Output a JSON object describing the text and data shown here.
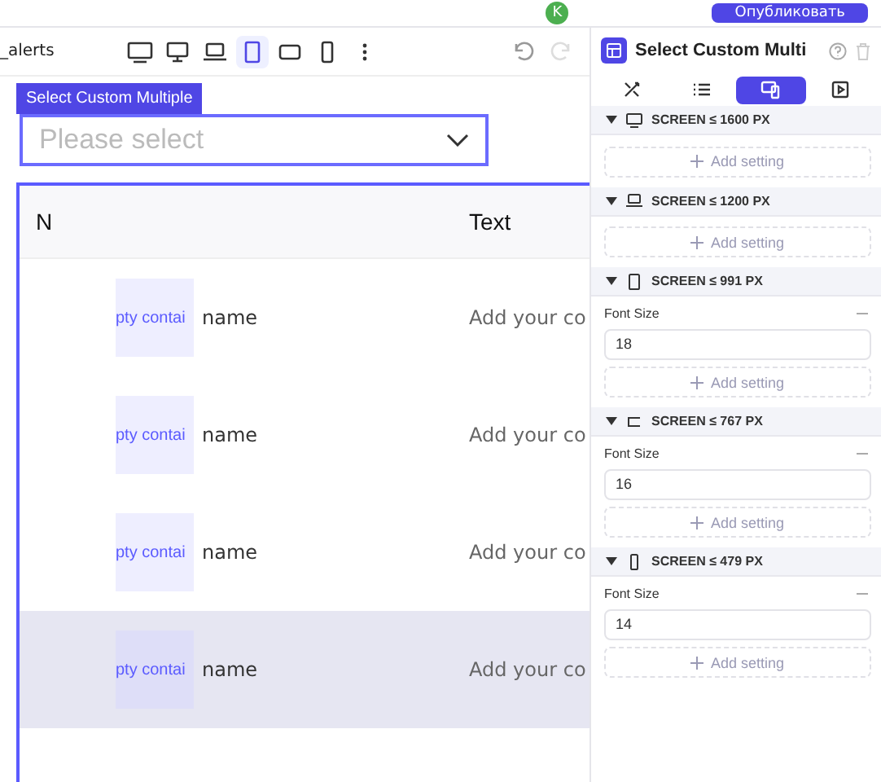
{
  "top_bar": {
    "avatar": "K",
    "publish_button": "Опубликовать"
  },
  "toolbar": {
    "page_name": "_alerts",
    "devices": [
      {
        "kind": "desktop-wide",
        "selected": false
      },
      {
        "kind": "desktop",
        "selected": false
      },
      {
        "kind": "laptop",
        "selected": false
      },
      {
        "kind": "tablet",
        "selected": true
      },
      {
        "kind": "tablet-landscape",
        "selected": false
      },
      {
        "kind": "phone",
        "selected": false
      }
    ]
  },
  "canvas": {
    "select_label": "Select Custom Multiple",
    "select_placeholder": "Please select",
    "table": {
      "columns": [
        "N",
        "Text"
      ],
      "rows": [
        {
          "tag": "pty contai",
          "name": "name",
          "text": "Add your co",
          "highlighted": false
        },
        {
          "tag": "pty contai",
          "name": "name",
          "text": "Add your co",
          "highlighted": false
        },
        {
          "tag": "pty contai",
          "name": "name",
          "text": "Add your co",
          "highlighted": false
        },
        {
          "tag": "pty contai",
          "name": "name",
          "text": "Add your co",
          "highlighted": true
        }
      ]
    }
  },
  "panel": {
    "title": "Select Custom Multi",
    "tabs": [
      {
        "kind": "style",
        "selected": false
      },
      {
        "kind": "list",
        "selected": false
      },
      {
        "kind": "responsive",
        "selected": true
      },
      {
        "kind": "play",
        "selected": false
      }
    ],
    "sections": [
      {
        "kind": "desktop",
        "title": "SCREEN ≤ 1600 PX",
        "add": "Add setting"
      },
      {
        "kind": "laptop",
        "title": "SCREEN ≤ 1200 PX",
        "add": "Add setting"
      },
      {
        "kind": "tablet",
        "title": "SCREEN ≤ 991 PX",
        "fields": [
          {
            "label": "Font Size",
            "value": "18"
          }
        ],
        "add": "Add setting"
      },
      {
        "kind": "landscape",
        "title": "SCREEN ≤ 767 PX",
        "fields": [
          {
            "label": "Font Size",
            "value": "16"
          }
        ],
        "add": "Add setting"
      },
      {
        "kind": "phone",
        "title": "SCREEN ≤ 479 PX",
        "fields": [
          {
            "label": "Font Size",
            "value": "14"
          }
        ],
        "add": "Add setting"
      }
    ]
  }
}
